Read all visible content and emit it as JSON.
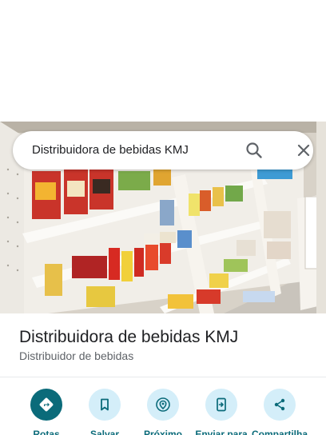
{
  "search": {
    "query": "Distribuidora de bebidas KMJ"
  },
  "place": {
    "name": "Distribuidora de bebidas KMJ",
    "category": "Distribuidor de bebidas"
  },
  "actions": [
    {
      "label": "Rotas",
      "icon": "directions-icon"
    },
    {
      "label": "Salvar",
      "icon": "bookmark-icon"
    },
    {
      "label": "Próximo",
      "icon": "nearby-icon"
    },
    {
      "label": "Enviar para",
      "icon": "send-to-phone-icon"
    },
    {
      "label": "Compartilha",
      "icon": "share-icon"
    }
  ],
  "colors": {
    "accent": "#0b6b7a",
    "action_bg": "#d4eef9",
    "text_primary": "#202124",
    "text_secondary": "#5f6368"
  }
}
